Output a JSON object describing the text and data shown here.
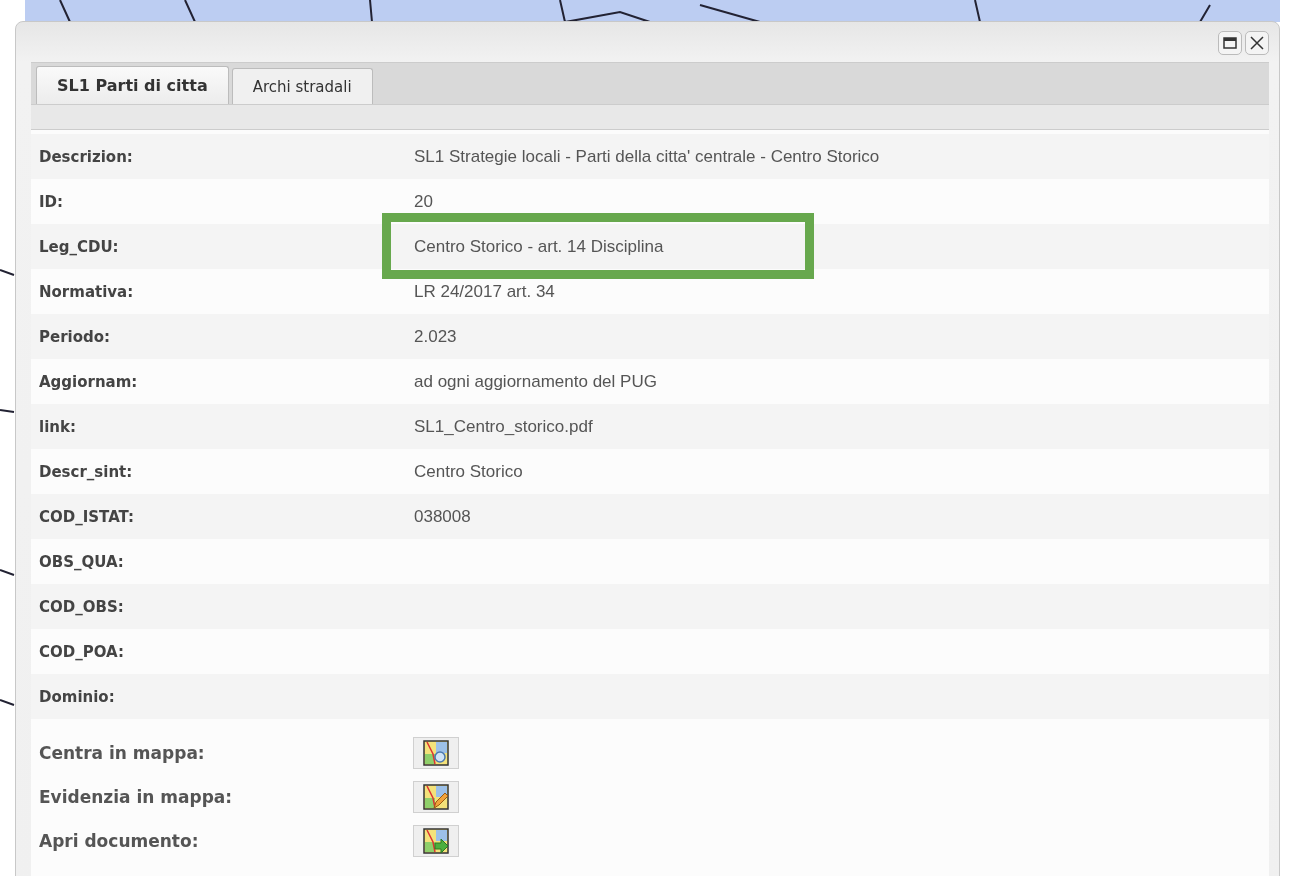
{
  "tabs": [
    {
      "label": "SL1 Parti di citta",
      "selected": true
    },
    {
      "label": "Archi stradali",
      "selected": false
    }
  ],
  "fields": [
    {
      "label": "Descrizion:",
      "value": "SL1 Strategie locali - Parti della citta' centrale - Centro Storico",
      "highlighted": false
    },
    {
      "label": "ID:",
      "value": "20",
      "highlighted": false
    },
    {
      "label": "Leg_CDU:",
      "value": "Centro Storico - art. 14 Disciplina",
      "highlighted": true
    },
    {
      "label": "Normativa:",
      "value": "LR 24/2017 art. 34",
      "highlighted": false
    },
    {
      "label": "Periodo:",
      "value": "2.023",
      "highlighted": false
    },
    {
      "label": "Aggiornam:",
      "value": "ad ogni aggiornamento del PUG",
      "highlighted": false
    },
    {
      "label": "link:",
      "value": "SL1_Centro_storico.pdf",
      "highlighted": false
    },
    {
      "label": "Descr_sint:",
      "value": "Centro Storico",
      "highlighted": false
    },
    {
      "label": "COD_ISTAT:",
      "value": "038008",
      "highlighted": false
    },
    {
      "label": "OBS_QUA:",
      "highlighted": false
    },
    {
      "label": "COD_OBS:",
      "highlighted": false
    },
    {
      "label": "COD_POA:",
      "highlighted": false
    },
    {
      "label": "Dominio:",
      "highlighted": false
    }
  ],
  "actions": [
    {
      "label": "Centra in mappa:",
      "kind": "zoom"
    },
    {
      "label": "Evidenzia in mappa:",
      "kind": "highlight"
    },
    {
      "label": "Apri documento:",
      "kind": "open"
    }
  ]
}
